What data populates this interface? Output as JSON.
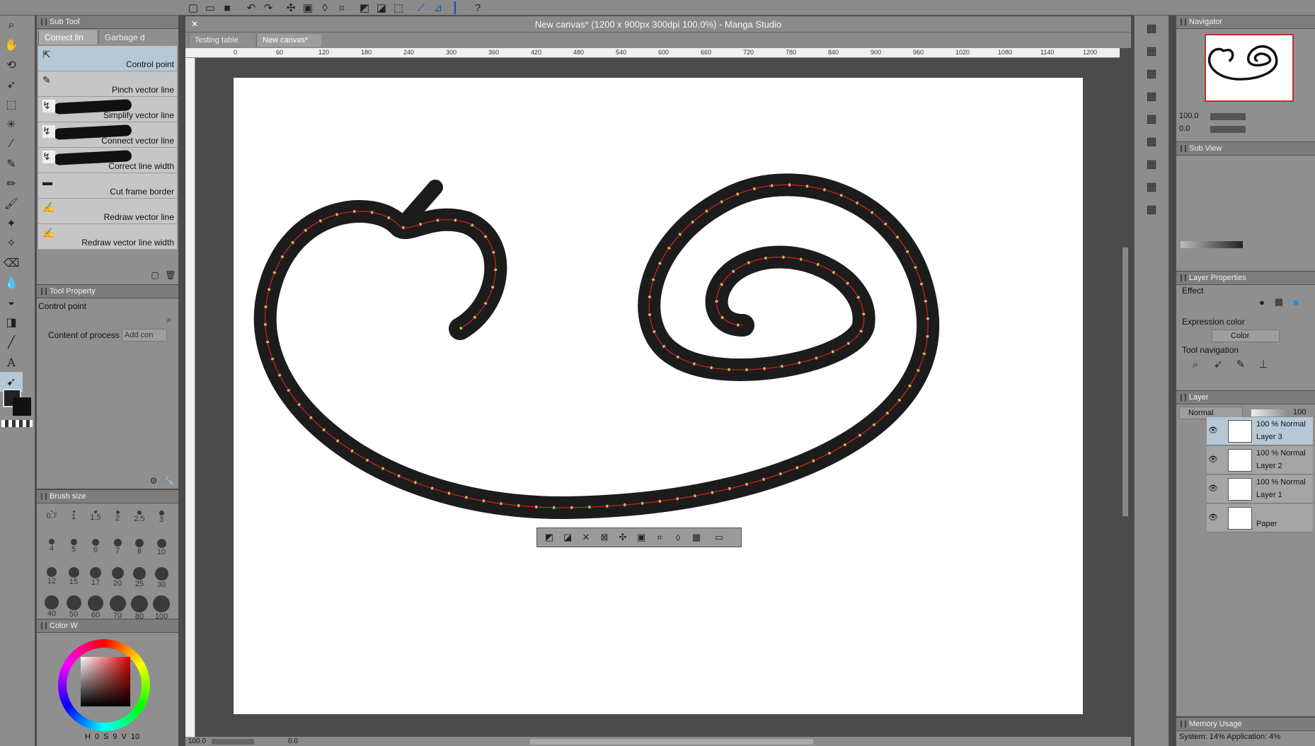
{
  "app": {
    "window_title": "New canvas* (1200 x 900px 300dpi 100.0%)  - Manga Studio"
  },
  "canvas_tabs": [
    {
      "label": "Testing table"
    },
    {
      "label": "New canvas*"
    }
  ],
  "subtool": {
    "panel_title": "Sub Tool",
    "tabs": [
      {
        "label": "Correct lin"
      },
      {
        "label": "Garbage d"
      }
    ],
    "items": [
      {
        "label": "Control point",
        "icon": "cursor-icon"
      },
      {
        "label": "Pinch vector line",
        "icon": "pinch-icon"
      },
      {
        "label": "Simplify vector line",
        "icon": "simplify-icon"
      },
      {
        "label": "Connect vector line",
        "icon": "connect-icon"
      },
      {
        "label": "Correct line width",
        "icon": "width-icon"
      },
      {
        "label": "Cut frame border",
        "icon": "frame-icon"
      },
      {
        "label": "Redraw vector line",
        "icon": "redraw-icon"
      },
      {
        "label": "Redraw vector line width",
        "icon": "redraw-width-icon"
      }
    ]
  },
  "tool_property": {
    "panel_title": "Tool Property",
    "tool_name": "Control point",
    "content_label": "Content of process",
    "content_value": "Add con"
  },
  "brush_size": {
    "panel_title": "Brush size",
    "sizes": [
      "0.7",
      "1",
      "1.5",
      "2",
      "2.5",
      "3",
      "4",
      "5",
      "6",
      "7",
      "8",
      "10",
      "12",
      "15",
      "17",
      "20",
      "25",
      "30",
      "40",
      "50",
      "60",
      "70",
      "80",
      "100"
    ]
  },
  "color_wheel": {
    "panel_title": "Color W",
    "h_label": "H",
    "h_value": "0",
    "s_label": "S",
    "s_value": "9",
    "v_label": "V",
    "v_value": "10"
  },
  "ruler": {
    "marks": [
      "0",
      "60",
      "120",
      "180",
      "240",
      "300",
      "360",
      "420",
      "480",
      "540",
      "600",
      "660",
      "720",
      "780",
      "840",
      "900",
      "960",
      "1020",
      "1080",
      "1140",
      "1200"
    ]
  },
  "status_bar": {
    "zoom": "100.0",
    "rotation": "0.0"
  },
  "navigator": {
    "panel_title": "Navigator",
    "zoom": "100.0",
    "angle": "0.0"
  },
  "sub_view": {
    "panel_title": "Sub View"
  },
  "layer_properties": {
    "panel_title": "Layer Properties",
    "effect_label": "Effect",
    "expression_label": "Expression color",
    "expression_value": "Color",
    "tool_nav_label": "Tool navigation"
  },
  "layer_panel": {
    "panel_title": "Layer",
    "blend_mode": "Normal",
    "opacity": "100",
    "layers": [
      {
        "mode": "100 % Normal",
        "name": "Layer 3",
        "selected": true
      },
      {
        "mode": "100 % Normal",
        "name": "Layer 2",
        "selected": false
      },
      {
        "mode": "100 % Normal",
        "name": "Layer 1",
        "selected": false
      },
      {
        "mode": "",
        "name": "Paper",
        "selected": false
      }
    ]
  },
  "memory": {
    "panel_title": "Memory Usage",
    "text": "System: 14%  Application:  4%"
  },
  "colors": {
    "selection_blue": "#b6c8d6",
    "stroke_red": "#e02020",
    "control_point": "#c8c060"
  }
}
